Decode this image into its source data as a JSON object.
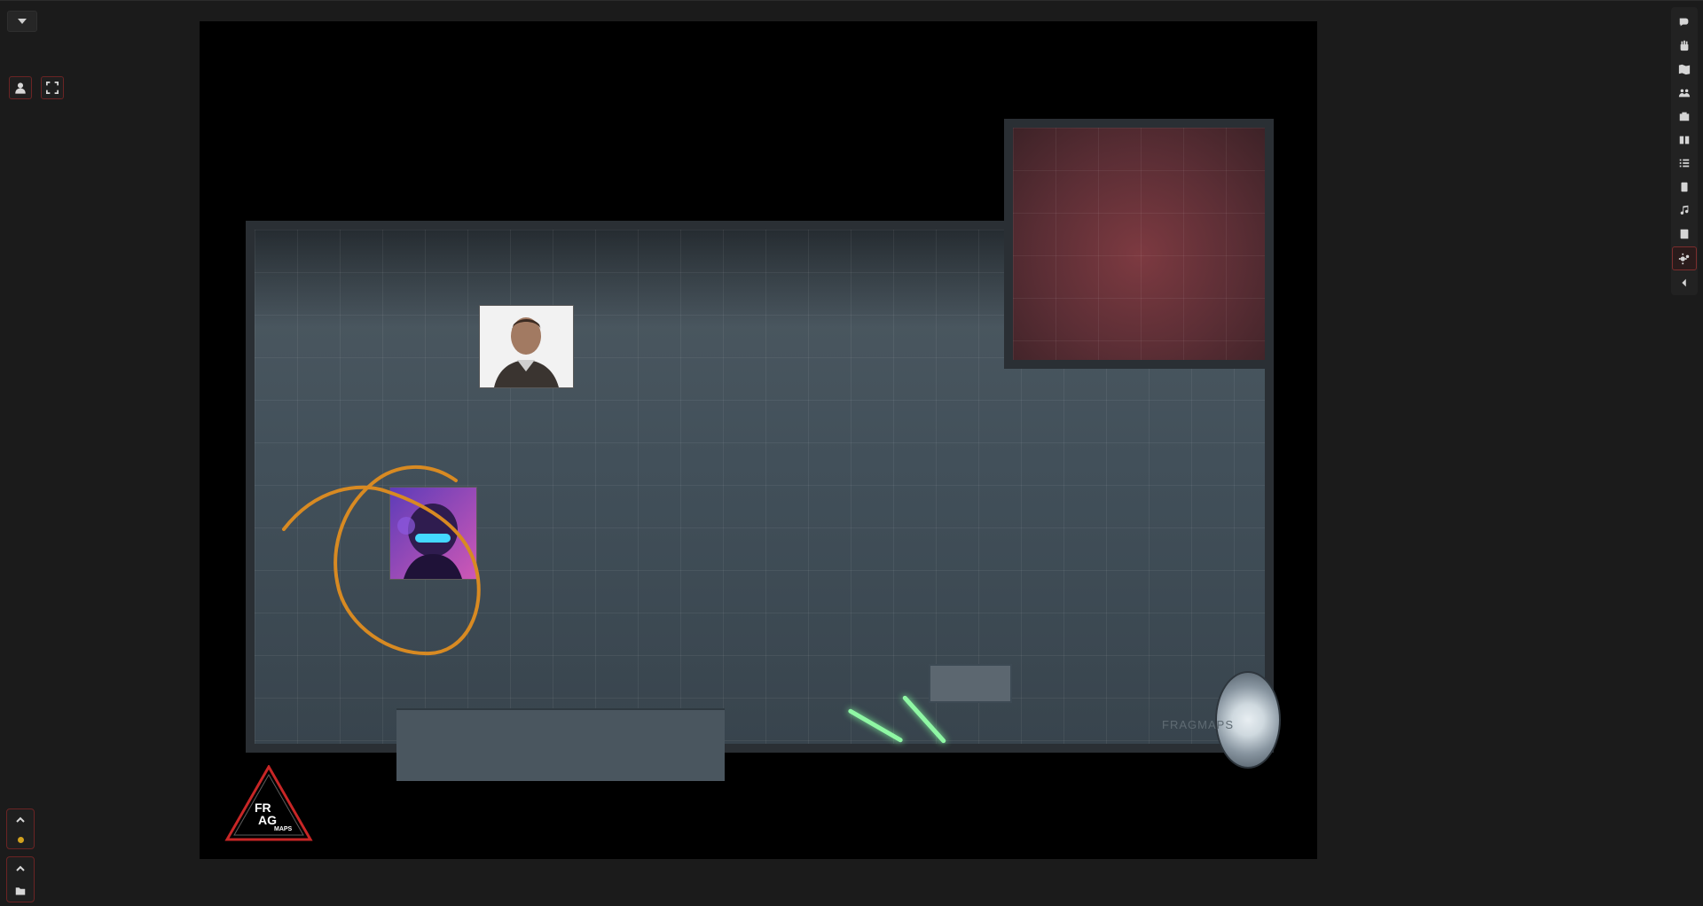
{
  "app": {
    "background": "#1b1b1b",
    "accent": "#7b2d2d"
  },
  "left_controls": {
    "dropdown_icon": "caret-down-icon",
    "buttons": [
      {
        "name": "user-icon"
      },
      {
        "name": "fullscreen-icon"
      }
    ],
    "bottom_panels": [
      {
        "icons": [
          "chevron-up-icon",
          "status-dot"
        ]
      },
      {
        "icons": [
          "chevron-up-icon",
          "folder-icon"
        ]
      }
    ]
  },
  "map": {
    "watermark": "FRAGMAPS"
  },
  "logo": {
    "line1": "FR",
    "line2": "AG",
    "line3": "MAPS"
  },
  "right_toolbar": [
    {
      "name": "chat-icon",
      "active": false
    },
    {
      "name": "combat-fist-icon",
      "active": false
    },
    {
      "name": "map-icon",
      "active": false
    },
    {
      "name": "players-icon",
      "active": false
    },
    {
      "name": "items-icon",
      "active": false
    },
    {
      "name": "journal-icon",
      "active": false
    },
    {
      "name": "tables-icon",
      "active": false
    },
    {
      "name": "cards-icon",
      "active": false
    },
    {
      "name": "music-icon",
      "active": false
    },
    {
      "name": "compendium-icon",
      "active": false
    },
    {
      "name": "settings-icon",
      "active": true
    },
    {
      "name": "collapse-left-icon",
      "active": false
    }
  ]
}
